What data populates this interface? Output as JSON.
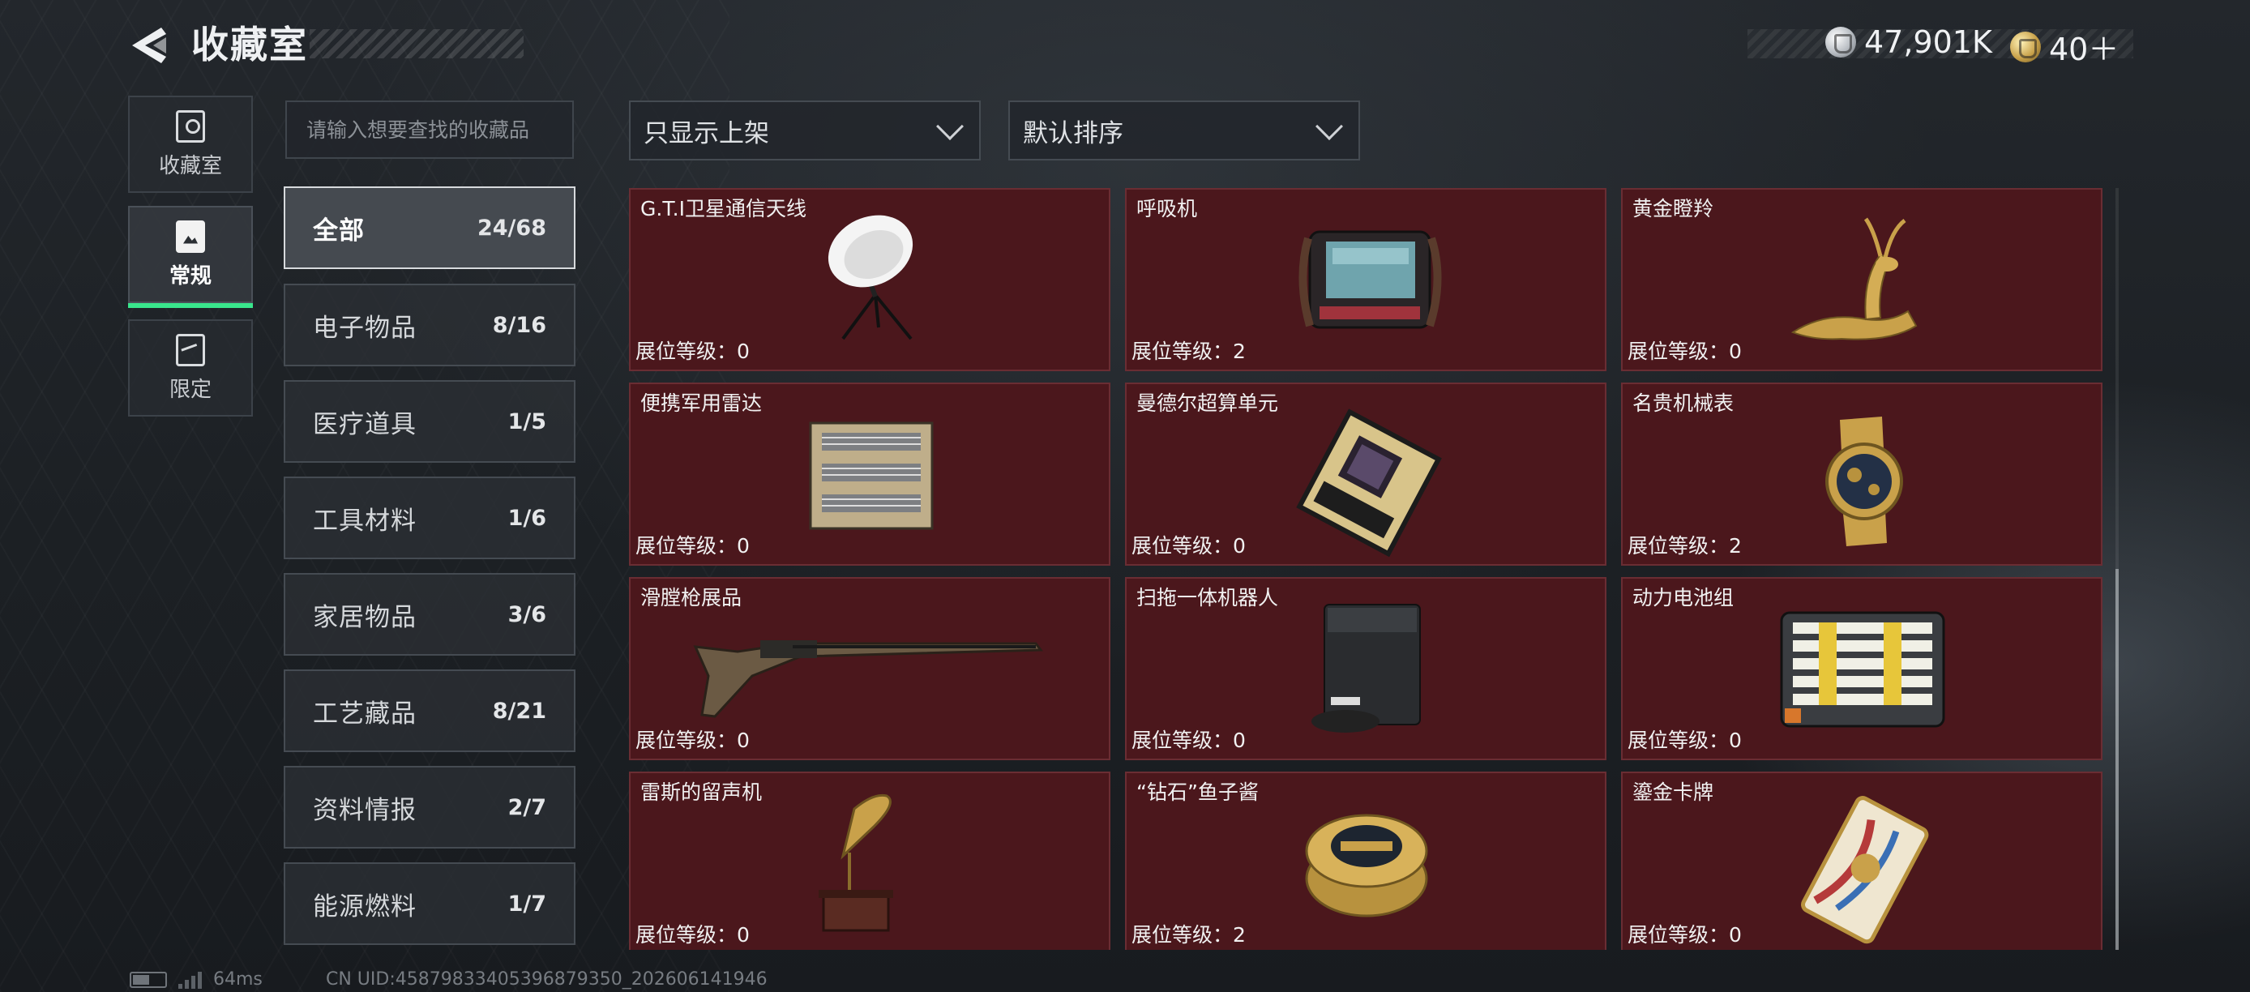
{
  "header": {
    "title": "收藏室",
    "currencies": [
      {
        "icon": "silver-coin-icon",
        "value": "47,901K"
      },
      {
        "icon": "gold-token-icon",
        "value": "40＋"
      }
    ]
  },
  "rail": {
    "tabs": [
      {
        "label": "收藏室",
        "icon": "collection-room-icon",
        "active": false
      },
      {
        "label": "常规",
        "icon": "regular-icon",
        "active": true
      },
      {
        "label": "限定",
        "icon": "limited-icon",
        "active": false
      }
    ],
    "active_indicator_color": "#39e68c"
  },
  "search": {
    "placeholder": "请输入想要查找的收藏品",
    "value": ""
  },
  "filters": {
    "display_filter": "只显示上架",
    "sort_order": "默认排序"
  },
  "categories": [
    {
      "name": "全部",
      "count": "24/68",
      "active": true
    },
    {
      "name": "电子物品",
      "count": "8/16"
    },
    {
      "name": "医疗道具",
      "count": "1/5"
    },
    {
      "name": "工具材料",
      "count": "1/6"
    },
    {
      "name": "家居物品",
      "count": "3/6"
    },
    {
      "name": "工艺藏品",
      "count": "8/21"
    },
    {
      "name": "资料情报",
      "count": "2/7"
    },
    {
      "name": "能源燃料",
      "count": "1/7"
    }
  ],
  "collection": {
    "level_label": "展位等级：",
    "card_color": "#4b171c",
    "items": [
      {
        "name": "G.T.I卫星通信天线",
        "level": "0",
        "icon": "satellite-dish-icon"
      },
      {
        "name": "呼吸机",
        "level": "2",
        "icon": "ventilator-icon"
      },
      {
        "name": "黄金瞪羚",
        "level": "0",
        "icon": "golden-gazelle-icon"
      },
      {
        "name": "便携军用雷达",
        "level": "0",
        "icon": "portable-radar-icon"
      },
      {
        "name": "曼德尔超算单元",
        "level": "0",
        "icon": "supercomputer-unit-icon"
      },
      {
        "name": "名贵机械表",
        "level": "2",
        "icon": "mechanical-watch-icon"
      },
      {
        "name": "滑膛枪展品",
        "level": "0",
        "icon": "musket-icon"
      },
      {
        "name": "扫拖一体机器人",
        "level": "0",
        "icon": "robot-vacuum-icon"
      },
      {
        "name": "动力电池组",
        "level": "0",
        "icon": "battery-pack-icon"
      },
      {
        "name": "雷斯的留声机",
        "level": "0",
        "icon": "gramophone-icon"
      },
      {
        "name": "“钻石”鱼子酱",
        "level": "2",
        "icon": "caviar-tin-icon"
      },
      {
        "name": "鎏金卡牌",
        "level": "0",
        "icon": "gilded-card-icon"
      }
    ]
  },
  "status_bar": {
    "ping": "64ms",
    "uid": "CN UID:4587983340539687935​0_202606141946"
  }
}
